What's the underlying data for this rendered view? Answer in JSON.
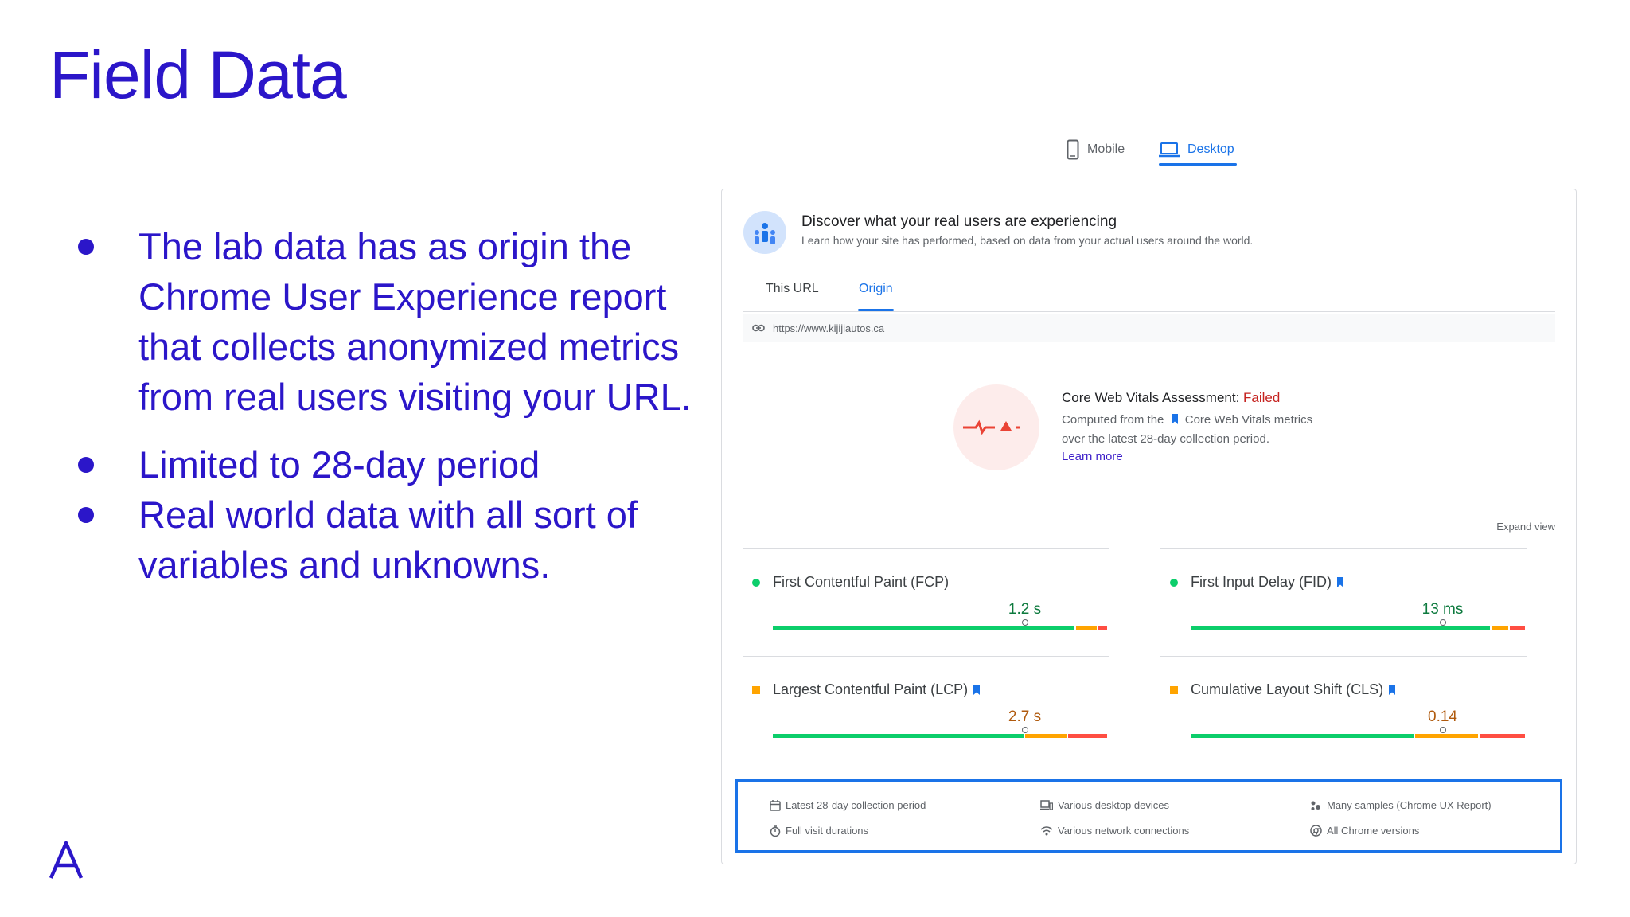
{
  "slide": {
    "title": "Field Data",
    "bullets": [
      "The lab data has as origin the Chrome User Experience report that collects anonymized metrics from real users visiting your URL.",
      "Limited to 28-day period",
      "Real world data with all sort of variables and unknowns."
    ],
    "accent_color": "#2b16c9"
  },
  "device_tabs": [
    {
      "label": "Mobile",
      "icon": "mobile-phone-icon",
      "active": false
    },
    {
      "label": "Desktop",
      "icon": "laptop-icon",
      "active": true
    }
  ],
  "panel": {
    "heading": "Discover what your real users are experiencing",
    "description": "Learn how your site has performed, based on data from your actual users around the world.",
    "scope_tabs": [
      {
        "label": "This URL",
        "active": false
      },
      {
        "label": "Origin",
        "active": true
      }
    ],
    "url": "https://www.kijijiautos.ca",
    "assessment": {
      "title": "Core Web Vitals Assessment: ",
      "status": "Failed",
      "line1_before": "Computed from the",
      "line1_after": "Core Web Vitals metrics",
      "line2": "over the latest 28-day collection period.",
      "learn_more": "Learn more",
      "status_color": "#c5221f"
    },
    "expand_view": "Expand view",
    "metrics": [
      {
        "name": "First Contentful Paint (FCP)",
        "value": "1.2 s",
        "rating": "good",
        "core": false,
        "distribution": {
          "good": 0.902,
          "needs_improvement": 0.068,
          "poor": 0.03
        },
        "marker": 0.75
      },
      {
        "name": "First Input Delay (FID)",
        "value": "13 ms",
        "rating": "good",
        "core": true,
        "distribution": {
          "good": 0.895,
          "needs_improvement": 0.055,
          "poor": 0.05
        },
        "marker": 0.75
      },
      {
        "name": "Largest Contentful Paint (LCP)",
        "value": "2.7 s",
        "rating": "needs-improvement",
        "core": true,
        "distribution": {
          "good": 0.75,
          "needs_improvement": 0.13,
          "poor": 0.12
        },
        "marker": 0.75
      },
      {
        "name": "Cumulative Layout Shift (CLS)",
        "value": "0.14",
        "rating": "needs-improvement",
        "core": true,
        "distribution": {
          "good": 0.668,
          "needs_improvement": 0.192,
          "poor": 0.14
        },
        "marker": 0.75
      }
    ],
    "footer": {
      "items": [
        {
          "text": "Latest 28-day collection period",
          "icon": "calendar-icon"
        },
        {
          "text": "Full visit durations",
          "icon": "timer-icon"
        },
        {
          "text": "Various desktop devices",
          "icon": "devices-icon"
        },
        {
          "text": "Various network connections",
          "icon": "wifi-icon"
        },
        {
          "text": "Many samples (",
          "link": "Chrome UX Report",
          "after": ")",
          "icon": "samples-icon"
        },
        {
          "text": "All Chrome versions",
          "icon": "chrome-icon"
        }
      ]
    },
    "colors": {
      "good": "#0cce6b",
      "needs_improvement": "#ffa400",
      "poor": "#ff4e42",
      "good_text": "#0d7a3e",
      "ni_text": "#b05a0d",
      "tab_active": "#1a73e8"
    }
  }
}
